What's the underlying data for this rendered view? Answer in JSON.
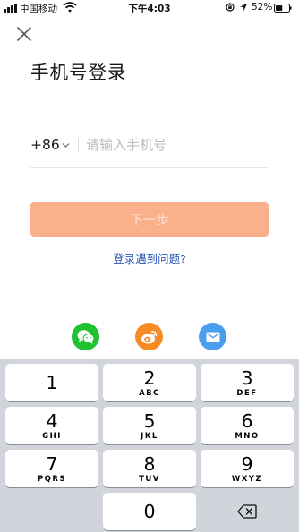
{
  "status_bar": {
    "carrier": "中国移动",
    "time": "下午4:03",
    "battery_percent": "52%",
    "battery_level": 0.52,
    "icons": [
      "signal-icon",
      "wifi-icon",
      "orientation-lock-icon",
      "location-icon",
      "battery-icon"
    ]
  },
  "header": {
    "close_icon": "close-icon",
    "title": "手机号登录"
  },
  "phone": {
    "country_code": "+86",
    "placeholder": "请输入手机号",
    "value": ""
  },
  "next_button": {
    "label": "下一步",
    "disabled": true
  },
  "help_link": "登录遇到问题?",
  "social_login": [
    "wechat-icon",
    "weibo-icon",
    "mail-icon"
  ],
  "colors": {
    "accent": "#fab08b",
    "link": "#2a57b8",
    "wechat": "#1fc230",
    "weibo": "#f68b25",
    "mail": "#4a9ef0",
    "keyboard_bg": "#d1d4da"
  },
  "keyboard": {
    "keys": [
      {
        "digit": "1",
        "letters": ""
      },
      {
        "digit": "2",
        "letters": "ABC"
      },
      {
        "digit": "3",
        "letters": "DEF"
      },
      {
        "digit": "4",
        "letters": "GHI"
      },
      {
        "digit": "5",
        "letters": "JKL"
      },
      {
        "digit": "6",
        "letters": "MNO"
      },
      {
        "digit": "7",
        "letters": "PQRS"
      },
      {
        "digit": "8",
        "letters": "TUV"
      },
      {
        "digit": "9",
        "letters": "WXYZ"
      },
      {
        "digit": "0",
        "letters": ""
      }
    ],
    "delete_icon": "backspace-icon"
  }
}
